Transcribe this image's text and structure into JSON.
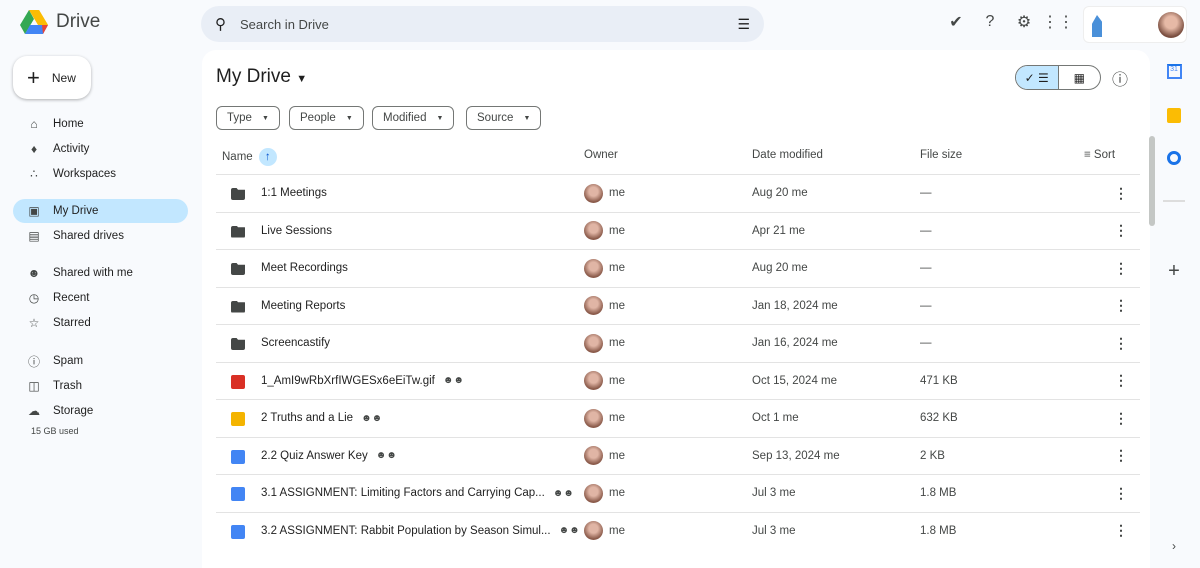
{
  "app": {
    "name": "Drive"
  },
  "search": {
    "placeholder": "Search in Drive"
  },
  "top_icons": [
    "ready-for-offline-icon",
    "help-icon",
    "settings-icon",
    "apps-icon"
  ],
  "new_label": "New",
  "sidebar": {
    "items": [
      {
        "label": "Home",
        "icon": "home-icon"
      },
      {
        "label": "Activity",
        "icon": "bell-icon"
      },
      {
        "label": "Workspaces",
        "icon": "workspaces-icon"
      },
      {
        "label": "My Drive",
        "icon": "my-drive-icon",
        "active": true
      },
      {
        "label": "Shared drives",
        "icon": "shared-drives-icon"
      },
      {
        "label": "Shared with me",
        "icon": "people-icon"
      },
      {
        "label": "Recent",
        "icon": "clock-icon"
      },
      {
        "label": "Starred",
        "icon": "star-icon"
      },
      {
        "label": "Spam",
        "icon": "spam-icon"
      },
      {
        "label": "Trash",
        "icon": "trash-icon"
      },
      {
        "label": "Storage",
        "icon": "cloud-icon"
      }
    ],
    "storage_used": "15 GB used"
  },
  "main": {
    "title": "My Drive",
    "filters": [
      "Type",
      "People",
      "Modified",
      "Source"
    ],
    "columns": {
      "name": "Name",
      "owner": "Owner",
      "date": "Date modified",
      "size": "File size",
      "sort": "Sort"
    },
    "rows": [
      {
        "name": "1:1 Meetings",
        "type": "shared-folder",
        "owner": "me",
        "date": "Aug 20 me",
        "size": "—"
      },
      {
        "name": "Live Sessions",
        "type": "shared-folder",
        "owner": "me",
        "date": "Apr 21 me",
        "size": "—"
      },
      {
        "name": "Meet Recordings",
        "type": "folder",
        "owner": "me",
        "date": "Aug 20 me",
        "size": "—"
      },
      {
        "name": "Meeting Reports",
        "type": "shared-folder",
        "owner": "me",
        "date": "Jan 18, 2024 me",
        "size": "—"
      },
      {
        "name": "Screencastify",
        "type": "shared-folder",
        "owner": "me",
        "date": "Jan 16, 2024 me",
        "size": "—"
      },
      {
        "name": "1_AmI9wRbXrfIWGESx6eEiTw.gif",
        "type": "image",
        "shared": true,
        "owner": "me",
        "date": "Oct 15, 2024 me",
        "size": "471 KB"
      },
      {
        "name": "2 Truths and a Lie",
        "type": "slides",
        "shared": true,
        "owner": "me",
        "date": "Oct 1 me",
        "size": "632 KB"
      },
      {
        "name": "2.2 Quiz Answer Key",
        "type": "doc",
        "shared": true,
        "owner": "me",
        "date": "Sep 13, 2024 me",
        "size": "2 KB"
      },
      {
        "name": "3.1 ASSIGNMENT: Limiting Factors and Carrying Cap...",
        "type": "doc",
        "shared": true,
        "owner": "me",
        "date": "Jul 3 me",
        "size": "1.8 MB"
      },
      {
        "name": "3.2 ASSIGNMENT: Rabbit Population by Season Simul...",
        "type": "doc",
        "shared": true,
        "owner": "me",
        "date": "Jul 3 me",
        "size": "1.8 MB"
      }
    ]
  },
  "colors": {
    "accent": "#c2e7ff",
    "folder": "#444746",
    "image": "#d93025",
    "slides": "#f4b400",
    "doc": "#4285f4"
  }
}
